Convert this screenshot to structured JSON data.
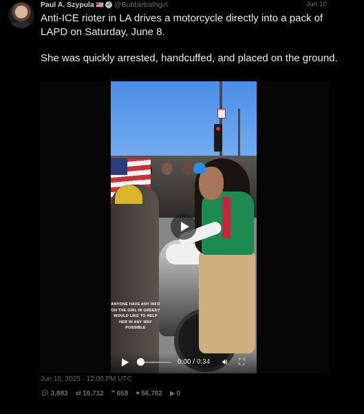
{
  "author": {
    "name": "Paul A. Szypula",
    "flag": "🇺🇸",
    "handle": "@Bubblebathgirl",
    "date_short": "Jun 10"
  },
  "tweet": {
    "paragraph1": "Anti-ICE rioter in LA drives a motorcycle directly into a pack of LAPD on Saturday, June 8.",
    "paragraph2": "She was quickly arrested, handcuffed, and placed on the ground."
  },
  "video": {
    "caption": "ANYONE HAVE ANY INFO ON THE GIRL IN GREEN? WOULD LIKE TO HELP HER IN ANY WAY POSSIBLE",
    "current_time": "0:00",
    "duration": "0:34",
    "progress": 0
  },
  "timestamp": "Jun 10, 2025 · 12:00 PM UTC",
  "stats": {
    "replies": "3,883",
    "retweets": "10,712",
    "quotes": "658",
    "likes": "56,782",
    "views": "0"
  },
  "icons": {
    "reply": "speech-bubble-icon",
    "retweet": "retweet-icon",
    "quote": "quote-icon",
    "like": "heart-icon",
    "views": "play-icon"
  }
}
